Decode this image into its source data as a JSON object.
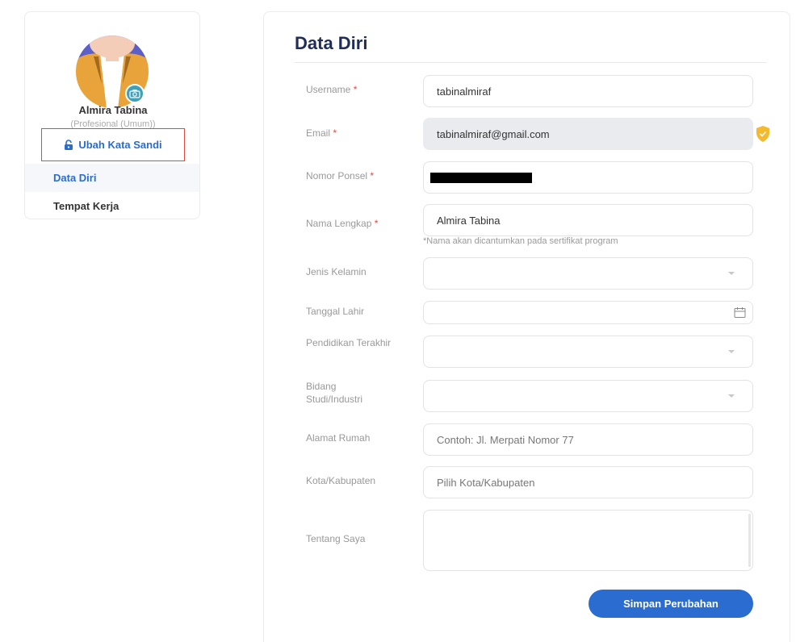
{
  "profile": {
    "name": "Almira Tabina",
    "role": "(Profesional (Umum))",
    "change_password_label": "Ubah Kata Sandi"
  },
  "menu": {
    "items": [
      {
        "label": "Data Diri",
        "active": true
      },
      {
        "label": "Tempat Kerja",
        "active": false
      }
    ]
  },
  "form": {
    "title": "Data Diri",
    "username": {
      "label": "Username",
      "value": "tabinalmiraf"
    },
    "email": {
      "label": "Email",
      "value": "tabinalmiraf@gmail.com"
    },
    "phone": {
      "label": "Nomor Ponsel",
      "value": ""
    },
    "fullname": {
      "label": "Nama Lengkap",
      "value": "Almira Tabina",
      "hint": "*Nama akan dicantumkan pada sertifikat program"
    },
    "gender": {
      "label": "Jenis Kelamin",
      "value": ""
    },
    "birthdate": {
      "label": "Tanggal Lahir",
      "value": ""
    },
    "education": {
      "label": "Pendidikan Terakhir",
      "value": ""
    },
    "field_of_study": {
      "label": "Bidang Studi/Industri",
      "value": ""
    },
    "address": {
      "label": "Alamat Rumah",
      "placeholder": "Contoh: Jl. Merpati Nomor 77"
    },
    "city": {
      "label": "Kota/Kabupaten",
      "placeholder": "Pilih Kota/Kabupaten"
    },
    "about": {
      "label": "Tentang Saya",
      "value": ""
    },
    "required_mark": "*",
    "save_label": "Simpan Perubahan"
  },
  "colors": {
    "accent": "#2a6ccf",
    "title": "#1f2d57",
    "required": "#e2483c",
    "verified": "#f5b92e"
  },
  "icons": {
    "camera": "camera-icon",
    "lock": "lock-icon",
    "verified": "shield-check-icon",
    "calendar": "calendar-icon",
    "dropdown": "chevron-down-icon"
  }
}
